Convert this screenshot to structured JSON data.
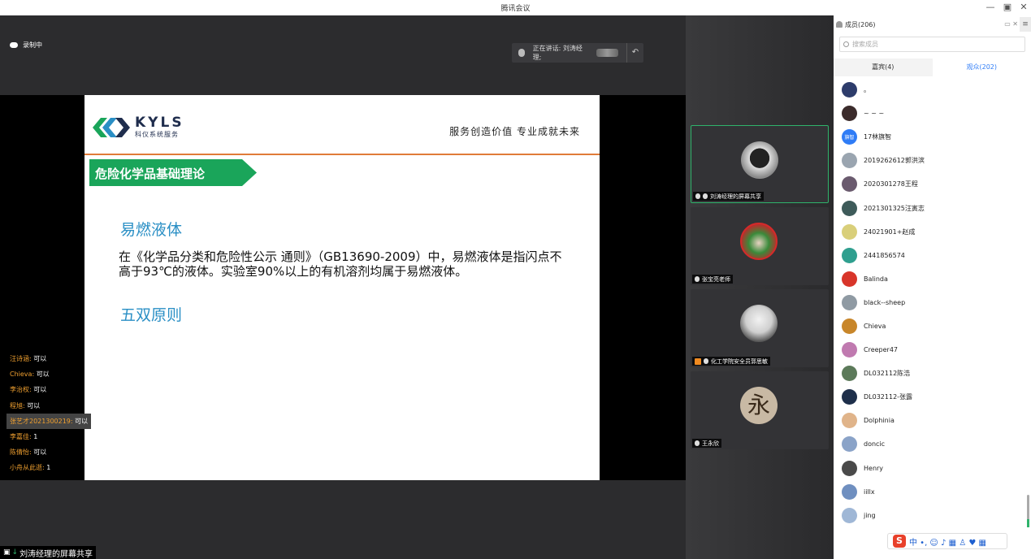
{
  "window": {
    "title": "腾讯会议",
    "controls": [
      "—",
      "▣",
      "✕"
    ]
  },
  "main": {
    "recording_label": "录制中",
    "speaking_label": "正在讲话: 刘涛经理;",
    "share_label": "刘涛经理的屏幕共享"
  },
  "slide": {
    "logo_text": "KYLS",
    "logo_subtext": "科仪系统服务",
    "motto": "服务创造价值 专业成就未来",
    "banner": "危险化学品基础理论",
    "heading1": "易燃液体",
    "paragraph": "在《化学品分类和危险性公示 通则》（GB13690-2009）中，易燃液体是指闪点不高于93℃的液体。实验室90%以上的有机溶剂均属于易燃液体。",
    "heading2": "五双原则",
    "colors": {
      "banner": "#1aa55a",
      "rule": "#e07b39",
      "heading": "#2a8fc5"
    }
  },
  "chat": [
    {
      "name": "汪诗涵:",
      "text": "可以"
    },
    {
      "name": "Chieva:",
      "text": "可以"
    },
    {
      "name": "李治权:",
      "text": "可以"
    },
    {
      "name": "程旭:",
      "text": "可以"
    },
    {
      "name": "张艺才2021300219:",
      "text": "可以"
    },
    {
      "name": "李嘉佳:",
      "text": "1"
    },
    {
      "name": "陈倩怡:",
      "text": "可以"
    },
    {
      "name": "小舟从此逝:",
      "text": "1"
    }
  ],
  "videos": [
    {
      "label": "刘涛经理的屏幕共享",
      "avatar": "motorbike-avatar"
    },
    {
      "label": "张宝亮老师",
      "avatar": "flower-avatar"
    },
    {
      "label": "化工学院安全员郭思敏",
      "avatar": "glasses-man-avatar"
    },
    {
      "label": "王永欣",
      "avatar": "yong-char-avatar",
      "char": "永"
    }
  ],
  "panel": {
    "title": "成员(206)",
    "search_placeholder": "搜索成员",
    "tabs": [
      "嘉宾(4)",
      "观众(202)"
    ],
    "members": [
      {
        "name": "。",
        "color": "#2d3c6b"
      },
      {
        "name": "~ ~ ~",
        "color": "#3b2b2b"
      },
      {
        "name": "17林旗智",
        "color": "#2f7cf6",
        "badge": "旗智"
      },
      {
        "name": "2019262612郭洪滨",
        "color": "#9aa5b0"
      },
      {
        "name": "2020301278王程",
        "color": "#6a5a6e"
      },
      {
        "name": "2021301325汪寅志",
        "color": "#3e5b5a"
      },
      {
        "name": "24021901+赵成",
        "color": "#d9cf7a"
      },
      {
        "name": "2441856574",
        "color": "#2f9f8f"
      },
      {
        "name": "Balinda",
        "color": "#d8352a"
      },
      {
        "name": "black--sheep",
        "color": "#8f9aa3"
      },
      {
        "name": "Chieva",
        "color": "#c8862a"
      },
      {
        "name": "Creeper47",
        "color": "#c07ab0"
      },
      {
        "name": "DL032112陈浩",
        "color": "#5c7a5a"
      },
      {
        "name": "DL032112-张露",
        "color": "#1e2f4a"
      },
      {
        "name": "Dolphinia",
        "color": "#e0b48a"
      },
      {
        "name": "doncic",
        "color": "#8aa3c8"
      },
      {
        "name": "Henry",
        "color": "#4a4a4a"
      },
      {
        "name": "iillx",
        "color": "#6f8fc0"
      },
      {
        "name": "jing",
        "color": "#9fb7d6"
      }
    ]
  },
  "ime": {
    "logo": "S",
    "text": "中 •, ☺ ♪ ▦ ♙ ♥ ▦"
  }
}
